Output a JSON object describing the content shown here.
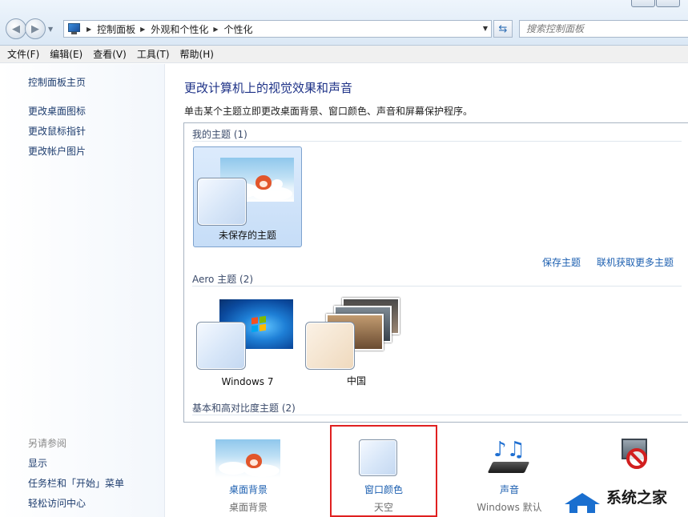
{
  "address_bar": {
    "breadcrumbs": [
      "控制面板",
      "外观和个性化",
      "个性化"
    ],
    "search_placeholder": "搜索控制面板"
  },
  "menu": [
    "文件(F)",
    "编辑(E)",
    "查看(V)",
    "工具(T)",
    "帮助(H)"
  ],
  "left_pane": {
    "home_link": "控制面板主页",
    "links": [
      "更改桌面图标",
      "更改鼠标指针",
      "更改帐户图片"
    ],
    "see_also_title": "另请参阅",
    "see_also": [
      "显示",
      "任务栏和「开始」菜单",
      "轻松访问中心"
    ]
  },
  "main": {
    "heading": "更改计算机上的视觉效果和声音",
    "subtitle": "单击某个主题立即更改桌面背景、窗口颜色、声音和屏幕保护程序。",
    "my_themes": {
      "title": "我的主题 (1)",
      "items": [
        {
          "label": "未保存的主题",
          "selected": true
        }
      ]
    },
    "save_theme_link": "保存主题",
    "get_more_link": "联机获取更多主题",
    "aero_themes": {
      "title": "Aero 主题 (2)",
      "items": [
        {
          "label": "Windows 7"
        },
        {
          "label": "中国"
        }
      ]
    },
    "basic_themes": {
      "title": "基本和高对比度主题 (2)"
    }
  },
  "bottom_bar": [
    {
      "label": "桌面背景",
      "sub": "桌面背景",
      "icon": "desktop-background-icon"
    },
    {
      "label": "窗口颜色",
      "sub": "天空",
      "icon": "window-color-icon"
    },
    {
      "label": "声音",
      "sub": "Windows 默认",
      "icon": "sound-icon"
    },
    {
      "label": "",
      "sub": "",
      "icon": "screensaver-icon"
    }
  ],
  "watermark": {
    "text": "系统之家"
  },
  "colors": {
    "link": "#1c5fb0",
    "heading": "#1e3287",
    "highlight": "#e02020",
    "selection": "#c6ddf7"
  }
}
